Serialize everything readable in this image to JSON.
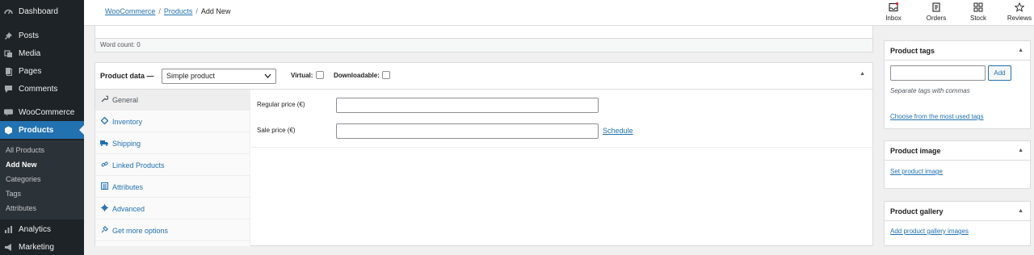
{
  "sidebar": {
    "items": [
      {
        "label": "Dashboard",
        "icon": "dashboard-icon"
      },
      {
        "label": "Posts",
        "icon": "pin-icon"
      },
      {
        "label": "Media",
        "icon": "media-icon"
      },
      {
        "label": "Pages",
        "icon": "page-icon"
      },
      {
        "label": "Comments",
        "icon": "comment-icon"
      },
      {
        "label": "WooCommerce",
        "icon": "woocommerce-icon"
      },
      {
        "label": "Products",
        "icon": "box-icon"
      },
      {
        "label": "Analytics",
        "icon": "bar-chart-icon"
      },
      {
        "label": "Marketing",
        "icon": "megaphone-icon"
      }
    ],
    "submenu": [
      "All Products",
      "Add New",
      "Categories",
      "Tags",
      "Attributes"
    ],
    "active_submenu": "Add New",
    "accent_color": "#2271b1"
  },
  "header": {
    "breadcrumb": [
      "WooCommerce",
      "Products",
      "Add New"
    ],
    "buttons": [
      {
        "label": "Inbox",
        "icon": "inbox-icon"
      },
      {
        "label": "Orders",
        "icon": "orders-icon"
      },
      {
        "label": "Stock",
        "icon": "stock-icon"
      },
      {
        "label": "Reviews",
        "icon": "star-icon"
      }
    ]
  },
  "editor": {
    "word_count": "Word count: 0"
  },
  "product_data": {
    "title": "Product data —",
    "product_type": "Simple product",
    "virtual_label": "Virtual:",
    "downloadable_label": "Downloadable:",
    "tabs": [
      {
        "label": "General",
        "icon": "wrench-icon"
      },
      {
        "label": "Inventory",
        "icon": "diamond-icon"
      },
      {
        "label": "Shipping",
        "icon": "truck-icon"
      },
      {
        "label": "Linked Products",
        "icon": "link-icon"
      },
      {
        "label": "Attributes",
        "icon": "list-icon"
      },
      {
        "label": "Advanced",
        "icon": "gear-icon"
      },
      {
        "label": "Get more options",
        "icon": "plugin-icon"
      }
    ],
    "active_tab": "General",
    "regular_price_label": "Regular price (€)",
    "regular_price_value": "",
    "sale_price_label": "Sale price (€)",
    "sale_price_value": "",
    "schedule_link": "Schedule"
  },
  "side_boxes": {
    "tags": {
      "title": "Product tags",
      "add_button": "Add",
      "help": "Separate tags with commas",
      "link": "Choose from the most used tags"
    },
    "image": {
      "title": "Product image",
      "link": "Set product image"
    },
    "gallery": {
      "title": "Product gallery",
      "link": "Add product gallery images"
    }
  }
}
